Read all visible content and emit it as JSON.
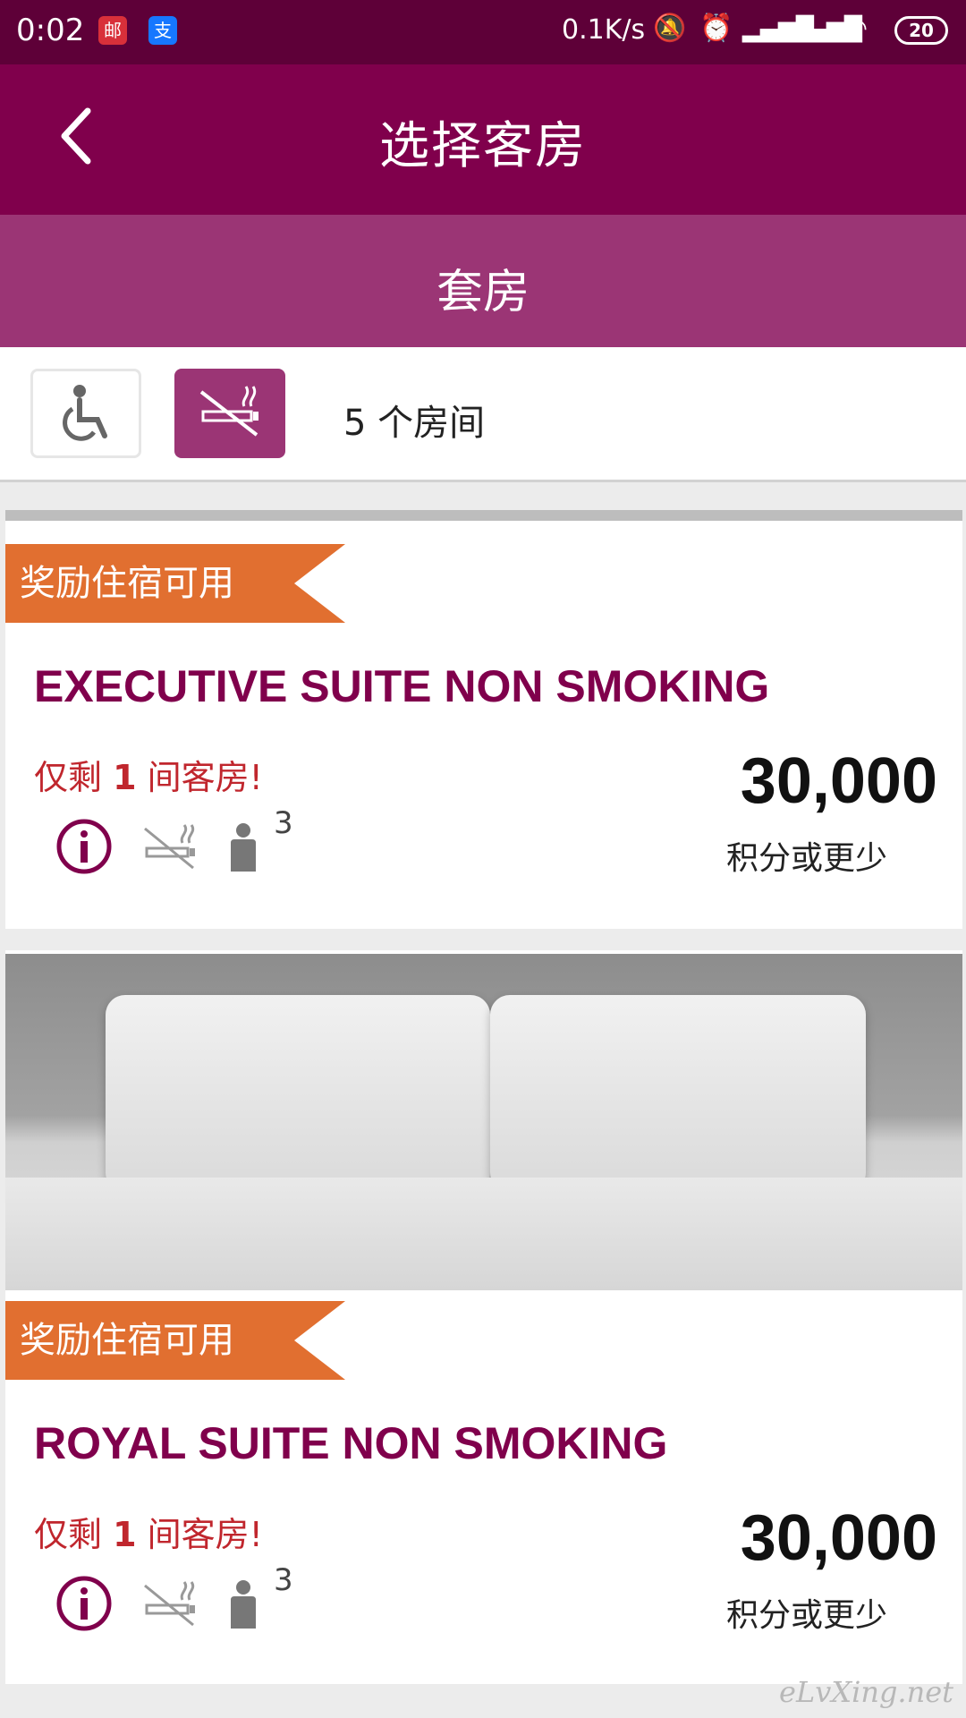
{
  "status_bar": {
    "time": "0:02",
    "app_icons": [
      "邮",
      "支"
    ],
    "network_speed": "0.1K/s",
    "battery": "20"
  },
  "header": {
    "title": "选择客房"
  },
  "sub_header": {
    "title": "套房"
  },
  "filters": {
    "accessible_icon": "wheelchair-icon",
    "non_smoking_icon": "no-smoking-icon",
    "room_count": "5 个房间"
  },
  "rooms": [
    {
      "badge": "奖励住宿可用",
      "name": "EXECUTIVE SUITE NON SMOKING",
      "availability_prefix": "仅剩 ",
      "availability_count": "1",
      "availability_suffix": " 间客房!",
      "occupancy": "3",
      "points": "30,000",
      "points_label": "积分或更少"
    },
    {
      "badge": "奖励住宿可用",
      "name": "ROYAL SUITE NON SMOKING",
      "availability_prefix": "仅剩 ",
      "availability_count": "1",
      "availability_suffix": " 间客房!",
      "occupancy": "3",
      "points": "30,000",
      "points_label": "积分或更少"
    }
  ],
  "watermark": "eLvXing.net",
  "colors": {
    "status_bar": "#5e0038",
    "header": "#80004c",
    "sub_header": "#9b3575",
    "ribbon": "#e16f30",
    "availability": "#c0262d"
  }
}
